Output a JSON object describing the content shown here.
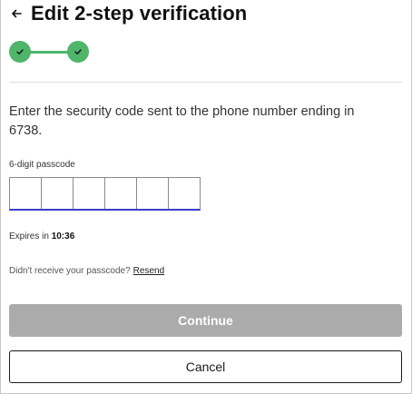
{
  "header": {
    "title": "Edit 2-step verification",
    "back_icon": "arrow-left-icon"
  },
  "stepper": {
    "steps_completed": 2,
    "steps_total": 2,
    "color": "#4fb56b",
    "step_icon": "checkmark-icon"
  },
  "instructions": "Enter the security code sent to the phone number ending in 6738.",
  "code_input": {
    "label": "6-digit passcode",
    "digits": 6,
    "values": [
      "",
      "",
      "",
      "",
      "",
      ""
    ]
  },
  "expires": {
    "prefix": "Expires in",
    "time": "10:36"
  },
  "resend": {
    "question": "Didn't receive your passcode?",
    "link_label": "Resend"
  },
  "actions": {
    "continue_label": "Continue",
    "cancel_label": "Cancel"
  },
  "colors": {
    "accent": "#4fb56b",
    "input_focus": "#3c3cc8",
    "disabled_button": "#ababab"
  }
}
